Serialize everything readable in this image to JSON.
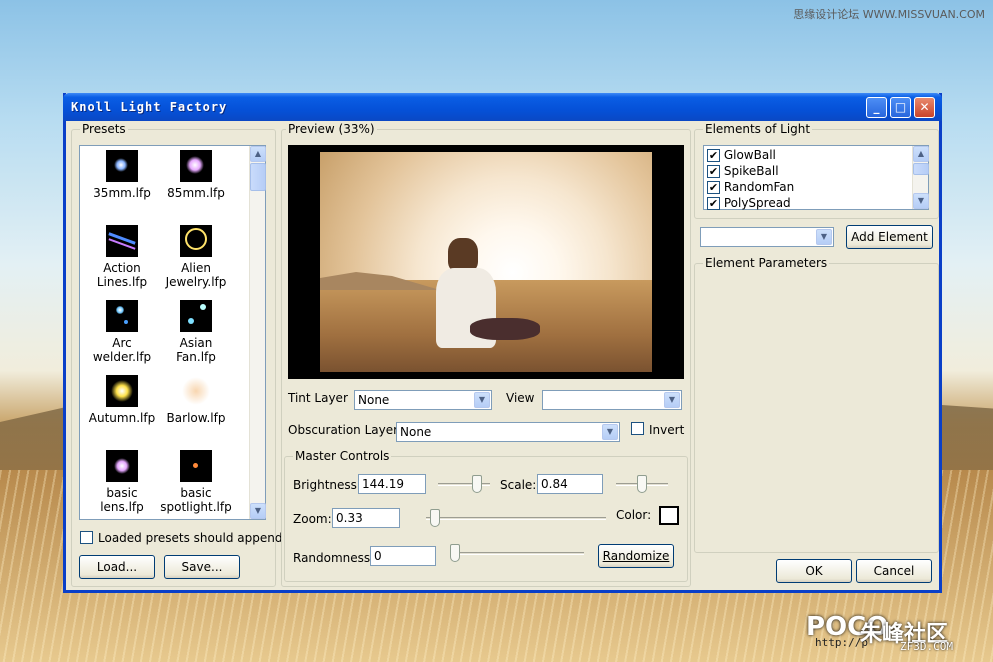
{
  "watermarks": {
    "top_right": "思缘设计论坛 WWW.MISSVUAN.COM",
    "poco": "POCO",
    "poco_url": "http://p",
    "zf_label": "朱峰社区",
    "zf_url": "ZF3D.COM"
  },
  "window": {
    "title": "Knoll Light Factory",
    "minimize": "_",
    "maximize": "□",
    "close": "✕"
  },
  "presets": {
    "label": "Presets",
    "items": [
      {
        "label": "35mm.lfp",
        "icon": "flare-35mm-icon"
      },
      {
        "label": "85mm.lfp",
        "icon": "flare-85mm-icon"
      },
      {
        "label": "Action Lines.lfp",
        "icon": "flare-action-lines-icon"
      },
      {
        "label": "Alien Jewelry.lfp",
        "icon": "flare-alien-jewelry-icon"
      },
      {
        "label": "Arc welder.lfp",
        "icon": "flare-arc-welder-icon"
      },
      {
        "label": "Asian Fan.lfp",
        "icon": "flare-asian-fan-icon"
      },
      {
        "label": "Autumn.lfp",
        "icon": "flare-autumn-icon"
      },
      {
        "label": "Barlow.lfp",
        "icon": "flare-barlow-icon"
      },
      {
        "label": "basic lens.lfp",
        "icon": "flare-basic-lens-icon"
      },
      {
        "label": "basic spotlight.lfp",
        "icon": "flare-basic-spotlight-icon"
      }
    ],
    "append_label": "Loaded presets should append",
    "append_checked": false,
    "load_button": "Load...",
    "save_button": "Save..."
  },
  "preview": {
    "label": "Preview (33%)"
  },
  "controls": {
    "tint_layer_label": "Tint Layer",
    "tint_layer_value": "None",
    "view_label": "View",
    "view_value": "",
    "obscuration_label": "Obscuration Layer",
    "obscuration_value": "None",
    "invert_label": "Invert",
    "invert_checked": false
  },
  "master": {
    "label": "Master Controls",
    "brightness_label": "Brightness:",
    "brightness_value": "144.19",
    "scale_label": "Scale:",
    "scale_value": "0.84",
    "zoom_label": "Zoom:",
    "zoom_value": "0.33",
    "color_label": "Color:",
    "color_value": "#ffffff",
    "randomness_label": "Randomness:",
    "randomness_value": "0",
    "randomize_button": "Randomize"
  },
  "elements": {
    "label": "Elements of Light",
    "items": [
      {
        "label": "GlowBall",
        "checked": true
      },
      {
        "label": "SpikeBall",
        "checked": true
      },
      {
        "label": "RandomFan",
        "checked": true
      },
      {
        "label": "PolySpread",
        "checked": true
      }
    ],
    "element_select_value": "",
    "add_button": "Add Element",
    "parameters_label": "Element Parameters"
  },
  "footer": {
    "ok_button": "OK",
    "cancel_button": "Cancel"
  }
}
